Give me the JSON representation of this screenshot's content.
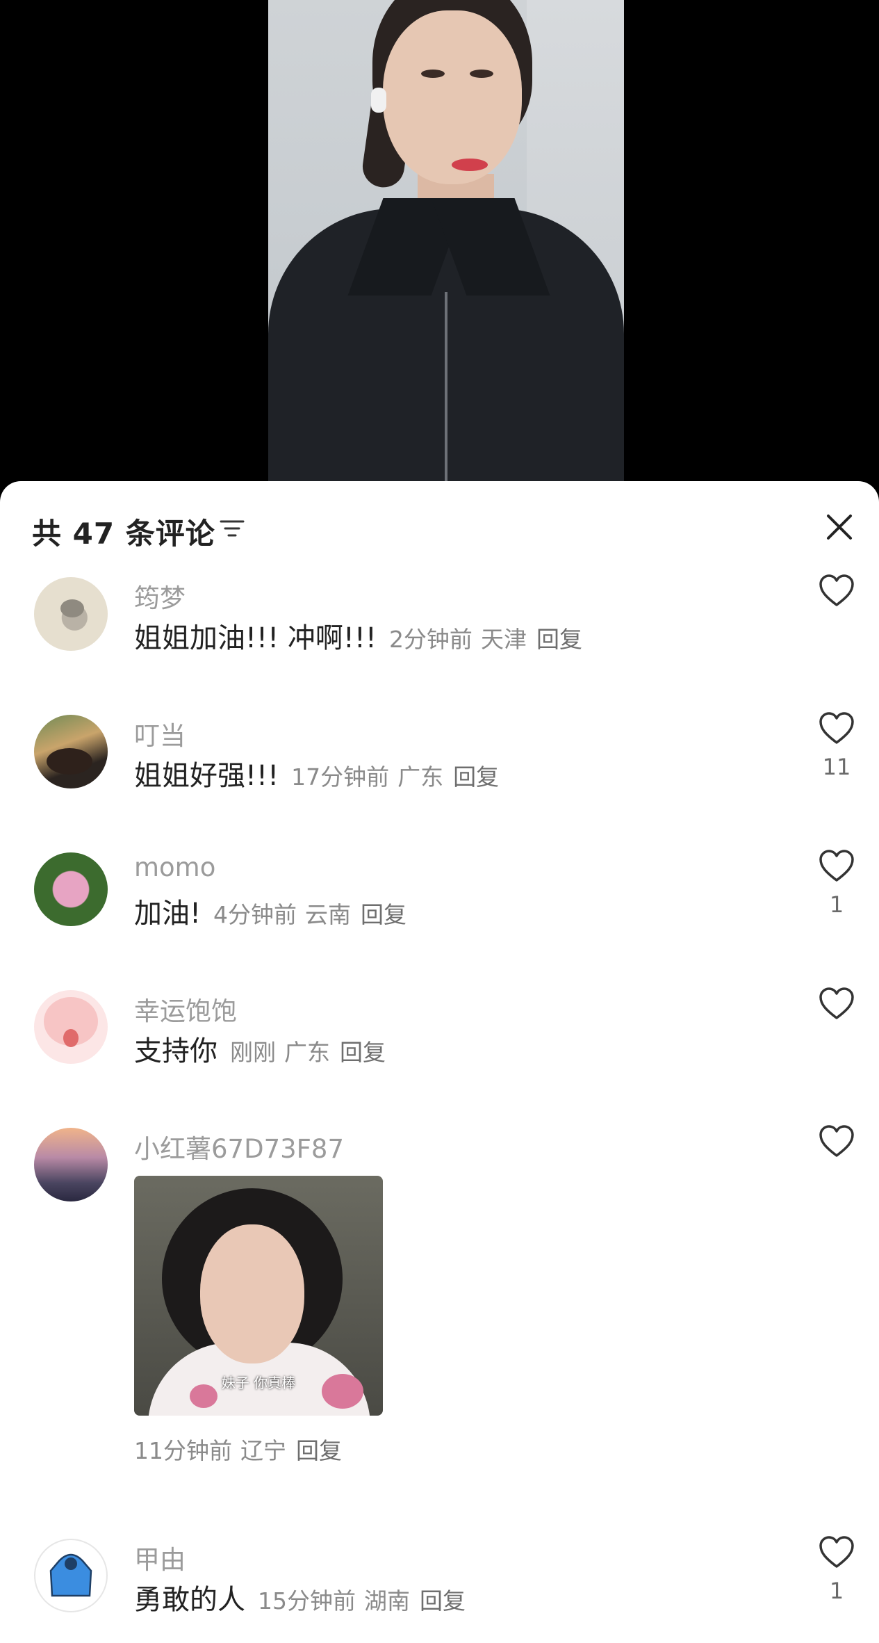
{
  "header": {
    "title": "共 47 条评论"
  },
  "comments": [
    {
      "username": "筠梦",
      "text": "姐姐加油!!! 冲啊!!!",
      "time": "2分钟前",
      "location": "天津",
      "reply": "回复",
      "likes": ""
    },
    {
      "username": "叮当",
      "text": "姐姐好强!!!",
      "time": "17分钟前",
      "location": "广东",
      "reply": "回复",
      "likes": "11"
    },
    {
      "username": "momo",
      "text": "加油!",
      "time": "4分钟前",
      "location": "云南",
      "reply": "回复",
      "likes": "1"
    },
    {
      "username": "幸运饱饱",
      "text": "支持你",
      "time": "刚刚",
      "location": "广东",
      "reply": "回复",
      "likes": ""
    },
    {
      "username": "小红薯67D73F87",
      "sticker_caption": "妹子 你真棒",
      "time": "11分钟前",
      "location": "辽宁",
      "reply": "回复",
      "likes": ""
    },
    {
      "username": "甲由",
      "text": "勇敢的人",
      "time": "15分钟前",
      "location": "湖南",
      "reply": "回复",
      "likes": "1"
    }
  ],
  "colors": {
    "sheet_bg": "#ffffff",
    "text": "#222222",
    "meta": "#8a8a8a",
    "username": "#9b9b9b"
  },
  "icons": {
    "sort": "sort-icon",
    "close": "close-icon",
    "like": "heart-outline-icon"
  }
}
